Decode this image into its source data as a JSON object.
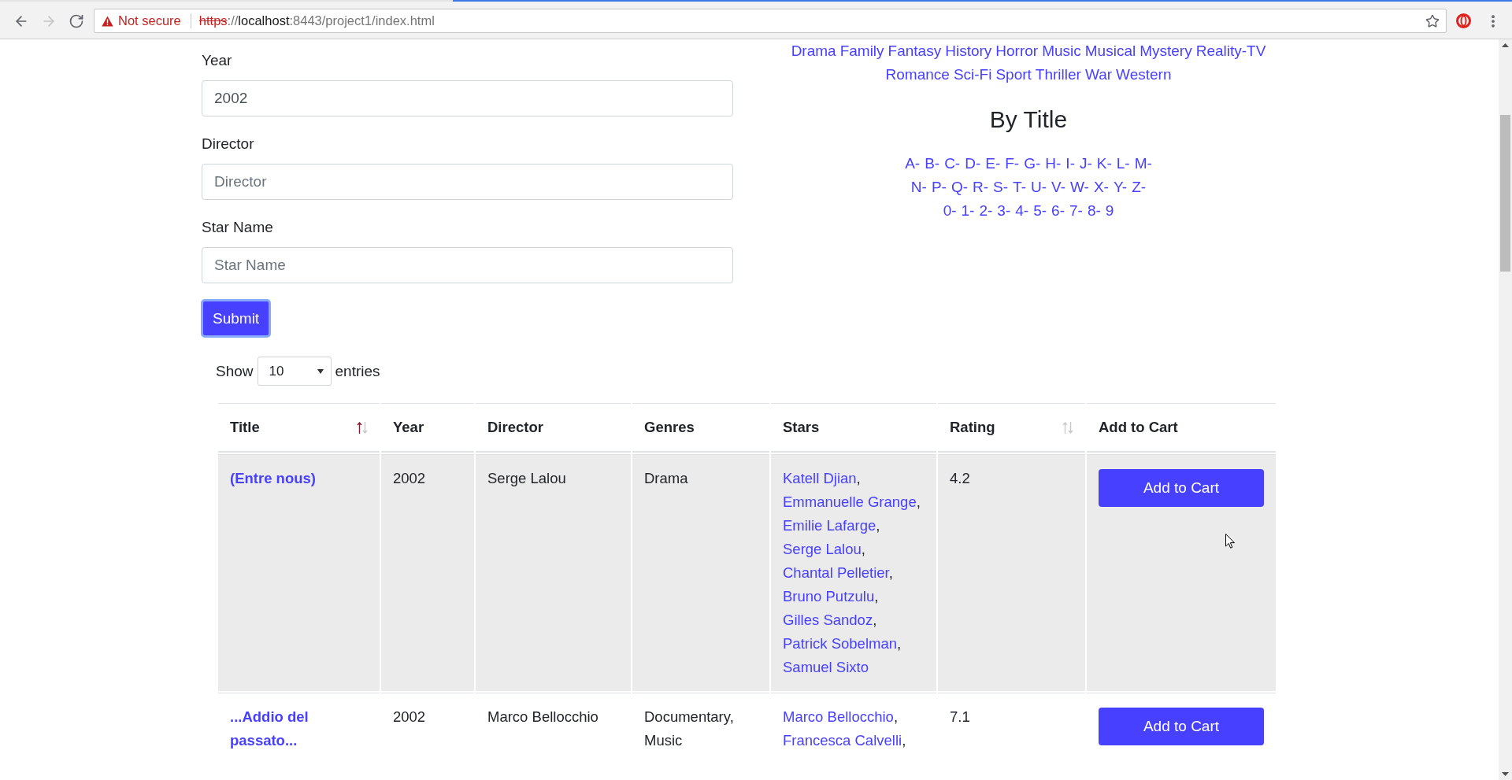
{
  "browser": {
    "nav_buttons": [
      {
        "kind": "back",
        "disabled": false
      },
      {
        "kind": "forward",
        "disabled": true
      },
      {
        "kind": "reload",
        "disabled": false
      }
    ],
    "security_label": "Not secure",
    "url_parts": [
      {
        "kind": "scheme",
        "text": "https"
      },
      {
        "kind": "muted",
        "text": "://"
      },
      {
        "kind": "host",
        "text": "localhost"
      },
      {
        "kind": "muted",
        "text": ":8443/project1/index.html"
      }
    ]
  },
  "search_form": {
    "fields": [
      {
        "label": "Year",
        "value": "2002"
      },
      {
        "label": "Director",
        "placeholder": "Director"
      },
      {
        "label": "Star Name",
        "placeholder": "Star Name"
      }
    ],
    "submit": {
      "label": "Submit",
      "focused": true
    }
  },
  "browse": {
    "genre_lines": [
      [
        "Drama",
        "Family",
        "Fantasy",
        "History",
        "Horror",
        "Music",
        "Musical",
        "Mystery",
        "Reality-TV"
      ],
      [
        "Romance",
        "Sci-Fi",
        "Sport",
        "Thriller",
        "War",
        "Western"
      ]
    ],
    "by_title_heading": "By Title",
    "title_lines": [
      [
        "A-",
        "B-",
        "C-",
        "D-",
        "E-",
        "F-",
        "G-",
        "H-",
        "I-",
        "J-",
        "K-",
        "L-",
        "M-"
      ],
      [
        "N-",
        "P-",
        "Q-",
        "R-",
        "S-",
        "T-",
        "U-",
        "V-",
        "W-",
        "X-",
        "Y-",
        "Z-"
      ],
      [
        "0-",
        "1-",
        "2-",
        "3-",
        "4-",
        "5-",
        "6-",
        "7-",
        "8-",
        "9"
      ]
    ]
  },
  "table": {
    "length_menu": {
      "before": "Show",
      "value": "10",
      "after": "entries"
    },
    "columns": [
      {
        "label": "Title",
        "sortable": true,
        "sorted": true
      },
      {
        "label": "Year",
        "sortable": false
      },
      {
        "label": "Director",
        "sortable": false
      },
      {
        "label": "Genres",
        "sortable": false
      },
      {
        "label": "Stars",
        "sortable": false
      },
      {
        "label": "Rating",
        "sortable": true,
        "sorted": false
      },
      {
        "label": "Add to Cart",
        "sortable": false
      }
    ],
    "rows": [
      {
        "hovered": true,
        "title": "(Entre nous)",
        "year": "2002",
        "director": "Serge Lalou",
        "genres": "Drama",
        "stars": [
          {
            "name": "Katell Djian",
            "separator": ","
          },
          {
            "name": "Emmanuelle Grange",
            "separator": ","
          },
          {
            "name": "Emilie Lafarge",
            "separator": ","
          },
          {
            "name": "Serge Lalou",
            "separator": ","
          },
          {
            "name": "Chantal Pelletier",
            "separator": ","
          },
          {
            "name": "Bruno Putzulu",
            "separator": ","
          },
          {
            "name": "Gilles Sandoz",
            "separator": ","
          },
          {
            "name": "Patrick Sobelman",
            "separator": ","
          },
          {
            "name": "Samuel Sixto"
          }
        ],
        "rating": "4.2",
        "action": "Add to Cart"
      },
      {
        "hovered": false,
        "title": "...Addio del passato...",
        "year": "2002",
        "director": "Marco Bellocchio",
        "genres": "Documentary, Music",
        "stars": [
          {
            "name": "Marco Bellocchio",
            "separator": ","
          },
          {
            "name": "Francesca Calvelli",
            "separator": ","
          }
        ],
        "rating": "7.1",
        "action": "Add to Cart"
      }
    ]
  }
}
